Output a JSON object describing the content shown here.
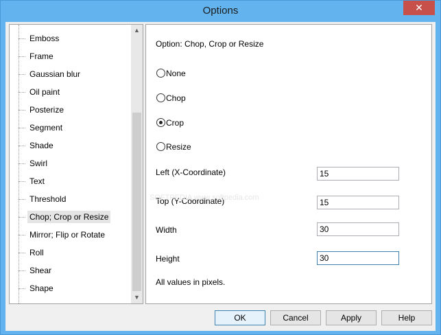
{
  "window": {
    "title": "Options",
    "close_glyph": "✕"
  },
  "tree": {
    "items": [
      {
        "label": "Emboss",
        "selected": false
      },
      {
        "label": "Frame",
        "selected": false
      },
      {
        "label": "Gaussian blur",
        "selected": false
      },
      {
        "label": "Oil paint",
        "selected": false
      },
      {
        "label": "Posterize",
        "selected": false
      },
      {
        "label": "Segment",
        "selected": false
      },
      {
        "label": "Shade",
        "selected": false
      },
      {
        "label": "Swirl",
        "selected": false
      },
      {
        "label": "Text",
        "selected": false
      },
      {
        "label": "Threshold",
        "selected": false
      },
      {
        "label": "Chop; Crop or Resize",
        "selected": true
      },
      {
        "label": "Mirror; Flip or Rotate",
        "selected": false
      },
      {
        "label": "Roll",
        "selected": false
      },
      {
        "label": "Shear",
        "selected": false
      },
      {
        "label": "Shape",
        "selected": false
      }
    ],
    "scroll_up_icon": "▲",
    "scroll_down_icon": "▼"
  },
  "panel": {
    "title": "Option: Chop, Crop or Resize",
    "radios": [
      {
        "label": "None",
        "checked": false
      },
      {
        "label": "Chop",
        "checked": false
      },
      {
        "label": "Crop",
        "checked": true
      },
      {
        "label": "Resize",
        "checked": false
      }
    ],
    "fields": [
      {
        "label": "Left (X-Coordinate)",
        "value": "15"
      },
      {
        "label": "Top (Y-Coordinate)",
        "value": "15"
      },
      {
        "label": "Width",
        "value": "30"
      },
      {
        "label": "Height",
        "value": "30"
      }
    ],
    "note": "All values in pixels."
  },
  "buttons": {
    "ok": "OK",
    "cancel": "Cancel",
    "apply": "Apply",
    "help": "Help"
  },
  "watermark": "SOFTPEDIA www.softpedia.com"
}
